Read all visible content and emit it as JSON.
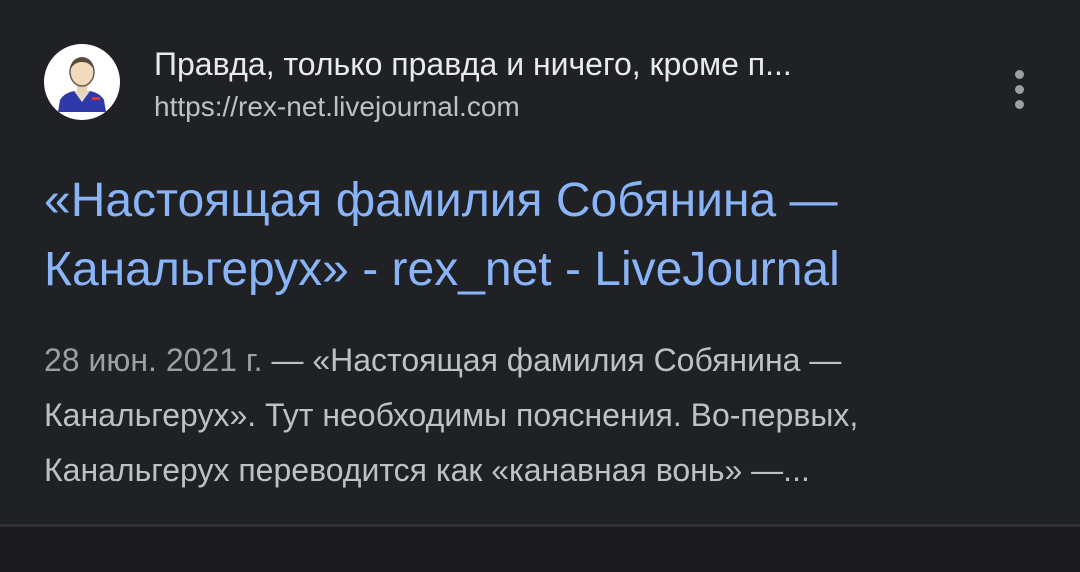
{
  "result": {
    "site_name": "Правда, только правда и ничего, кроме п...",
    "url": "https://rex-net.livejournal.com",
    "favicon_icon": "user-avatar-icon",
    "menu_icon": "more-vertical-icon",
    "title_line1": "«Настоящая фамилия Собянина —",
    "title_line2": "Канальгерух» - rex_net - LiveJournal",
    "date": "28 июн. 2021 г.",
    "separator": " — ",
    "snippet_line1": "«Настоящая фамилия Собянина —",
    "snippet_line2": "Канальгерух». Тут необходимы пояснения. Во-первых,",
    "snippet_line3": "Канальгерух переводится как «канавная вонь» —..."
  },
  "colors": {
    "background": "#202124",
    "title_link": "#8ab4f8",
    "primary_text": "#e8eaed",
    "secondary_text": "#bdc1c6",
    "date_text": "#9aa0a6"
  }
}
